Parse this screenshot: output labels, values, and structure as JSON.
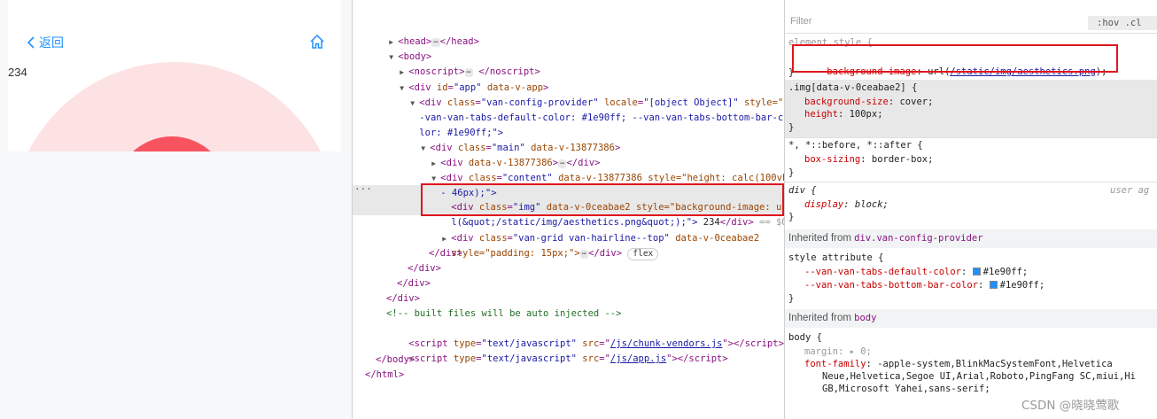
{
  "preview": {
    "back_label": "返回",
    "content_text": "234"
  },
  "elements": {
    "lines": [
      {
        "indent": 1,
        "tri": "▶",
        "html": "head_collapsed"
      },
      {
        "indent": 1,
        "tri": "▼",
        "html": "body_open"
      },
      {
        "indent": 2,
        "tri": "▶",
        "html": "noscript"
      },
      {
        "indent": 2,
        "tri": "▼",
        "html": "app_div"
      },
      {
        "indent": 3,
        "tri": "▼",
        "html": "van_config_1"
      },
      {
        "indent": 3,
        "tri": "",
        "html": "van_config_2"
      },
      {
        "indent": 3,
        "tri": "",
        "html": "van_config_3"
      },
      {
        "indent": 4,
        "tri": "▼",
        "html": "main_div"
      },
      {
        "indent": 5,
        "tri": "▶",
        "html": "inner_div"
      },
      {
        "indent": 5,
        "tri": "▼",
        "html": "content_div_1"
      },
      {
        "indent": 5,
        "tri": "",
        "html": "content_div_2"
      }
    ],
    "text": {
      "head": "<head>",
      "head_close": "</head>",
      "body": "<body>",
      "noscript": "<noscript>",
      "noscript_close": "</noscript>",
      "div_app_attr": "id",
      "div_app_val": "\"app\"",
      "data_v_app": "data-v-app",
      "vcp_class": "\"van-config-provider\"",
      "vcp_locale": "\"[object Object]\"",
      "vcp_style_1": "style=\"-",
      "vcp_style_2": "-van-van-tabs-default-color: #1e90ff; --van-van-tabs-bottom-bar-co",
      "vcp_style_3": "lor: #1e90ff;\">",
      "main_class": "\"main\"",
      "data_v_1387": "data-v-13877386",
      "content_class": "\"content\"",
      "content_style_1": "style=\"height: calc(100vh",
      "content_style_2": "- 46px);\">",
      "img_class": "\"img\"",
      "data_v_0cea": "data-v-0ceabae2",
      "img_style_1": "style=\"background-image: ur",
      "img_style_2": "l(&quot;/static/img/aesthetics.png&quot;);\">",
      "img_text": " 234",
      "img_eq": "== $0",
      "grid_class": "\"van-grid van-hairline--top\"",
      "grid_style": "style=\"padding: 15px;\">",
      "flex": "flex",
      "comment": "<!-- built files will be auto injected -->",
      "script_type": "\"text/javascript\"",
      "src1": "/js/chunk-vendors.js",
      "src2": "/js/app.js"
    }
  },
  "styles": {
    "filter_placeholder": "Filter",
    "hov": ":hov .cl",
    "element_style_sel": "element.style {",
    "bg_image_prop": "background-image",
    "bg_image_val_pre": "url(",
    "bg_image_link": "/static/img/aesthetics.png",
    "bg_image_val_post": ");",
    "img_sel": ".img[data-v-0ceabae2] {",
    "bg_size_prop": "background-size",
    "bg_size_val": "cover;",
    "height_prop": "height",
    "height_val": "100px;",
    "universal_sel": "*, *::before, *::after {",
    "box_sizing_prop": "box-sizing",
    "box_sizing_val": "border-box;",
    "div_sel": "div {",
    "user_agent": "user ag",
    "display_prop": "display",
    "display_val": "block;",
    "inherited_label_1": "Inherited from ",
    "inherited_from_1": "div.van-config-provider",
    "style_attr": "style attribute {",
    "var1_prop": "--van-van-tabs-default-color",
    "var1_val": "#1e90ff;",
    "var2_prop": "--van-van-tabs-bottom-bar-color",
    "var2_val": "#1e90ff;",
    "inherited_label_2": "Inherited from ",
    "inherited_from_2": "body",
    "body_sel": "body {",
    "margin_prop": "margin",
    "margin_val": "0;",
    "font_prop": "font-family",
    "font_val_1": "-apple-system,BlinkMacSystemFont,Helvetica",
    "font_val_2": "Neue,Helvetica,Segoe UI,Arial,Roboto,PingFang SC,miui,Hi",
    "font_val_3": "GB,Microsoft Yahei,sans-serif;",
    "close": "}"
  },
  "colors": {
    "accent": "#1e90ff",
    "highlight_border": "#e0141e"
  },
  "watermark": "CSDN @晓晓莺歌"
}
